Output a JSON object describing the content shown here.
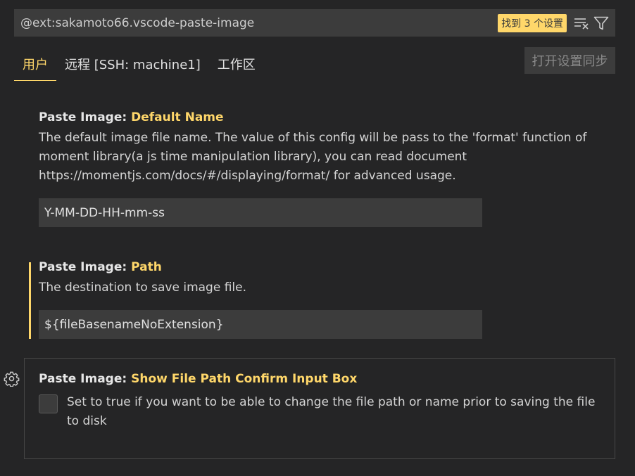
{
  "search": {
    "query": "@ext:sakamoto66.vscode-paste-image",
    "result_badge": "找到 3 个设置",
    "clear_icon": "clear-filter-icon",
    "filter_icon": "filter-icon"
  },
  "tabs": [
    {
      "label": "用户",
      "active": true
    },
    {
      "label": "远程 [SSH: machine1]",
      "active": false
    },
    {
      "label": "工作区",
      "active": false
    }
  ],
  "sync_button": "打开设置同步",
  "settings": [
    {
      "category": "Paste Image: ",
      "name": "Default Name",
      "description": "The default image file name. The value of this config will be pass to the 'format' function of moment library(a js time manipulation library), you can read document https://momentjs.com/docs/#/displaying/format/ for advanced usage.",
      "value": "Y-MM-DD-HH-mm-ss"
    },
    {
      "category": "Paste Image: ",
      "name": "Path",
      "description": "The destination to save image file.",
      "value": "${fileBasenameNoExtension}"
    },
    {
      "category": "Paste Image: ",
      "name": "Show File Path Confirm Input Box",
      "description": "Set to true if you want to be able to change the file path or name prior to saving the file to disk",
      "checked": false
    }
  ],
  "colors": {
    "accent": "#ffd76a",
    "background": "#252526",
    "input_background": "#3c3c3c"
  }
}
